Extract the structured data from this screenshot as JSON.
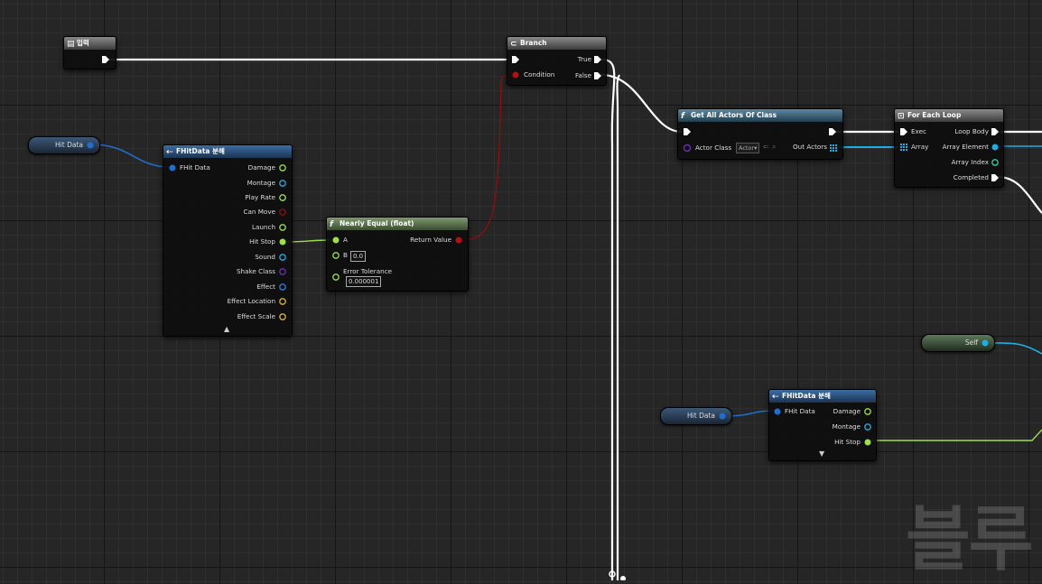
{
  "nodes": {
    "input": {
      "title": "입력"
    },
    "branch": {
      "title": "Branch",
      "condition": "Condition",
      "true_label": "True",
      "false_label": "False"
    },
    "get_actors": {
      "title": "Get All Actors Of Class",
      "actor_class": "Actor Class",
      "actor_class_value": "Actor",
      "out_actors": "Out Actors"
    },
    "for_each": {
      "title": "For Each Loop",
      "exec": "Exec",
      "loop_body": "Loop Body",
      "array": "Array",
      "array_element": "Array Element",
      "array_index": "Array Index",
      "completed": "Completed"
    },
    "break_top": {
      "title": "FHitData 분해",
      "input": "FHit Data",
      "outputs": [
        "Damage",
        "Montage",
        "Play Rate",
        "Can Move",
        "Launch",
        "Hit Stop",
        "Sound",
        "Shake Class",
        "Effect",
        "Effect Location",
        "Effect Scale"
      ]
    },
    "nearly_equal": {
      "title": "Nearly Equal (float)",
      "a": "A",
      "b": "B",
      "b_value": "0.0",
      "tolerance": "Error Tolerance",
      "tolerance_value": "0.000001",
      "return_value": "Return Value"
    },
    "break_bottom": {
      "title": "FHitData 분해",
      "input": "FHit Data",
      "outputs": [
        "Damage",
        "Montage",
        "Hit Stop"
      ]
    }
  },
  "variables": {
    "hit_data_top": "Hit Data",
    "hit_data_bottom": "Hit Data",
    "self": "Self"
  },
  "watermark": "블루",
  "colors": {
    "exec": "#ffffff",
    "struct": "#1e6fd0",
    "float": "#9be04a",
    "bool": "#8a0f0f",
    "object": "#1eaee6",
    "class": "#6b2fb3",
    "byte": "#d8b436",
    "asset": "#2e7fd6"
  }
}
